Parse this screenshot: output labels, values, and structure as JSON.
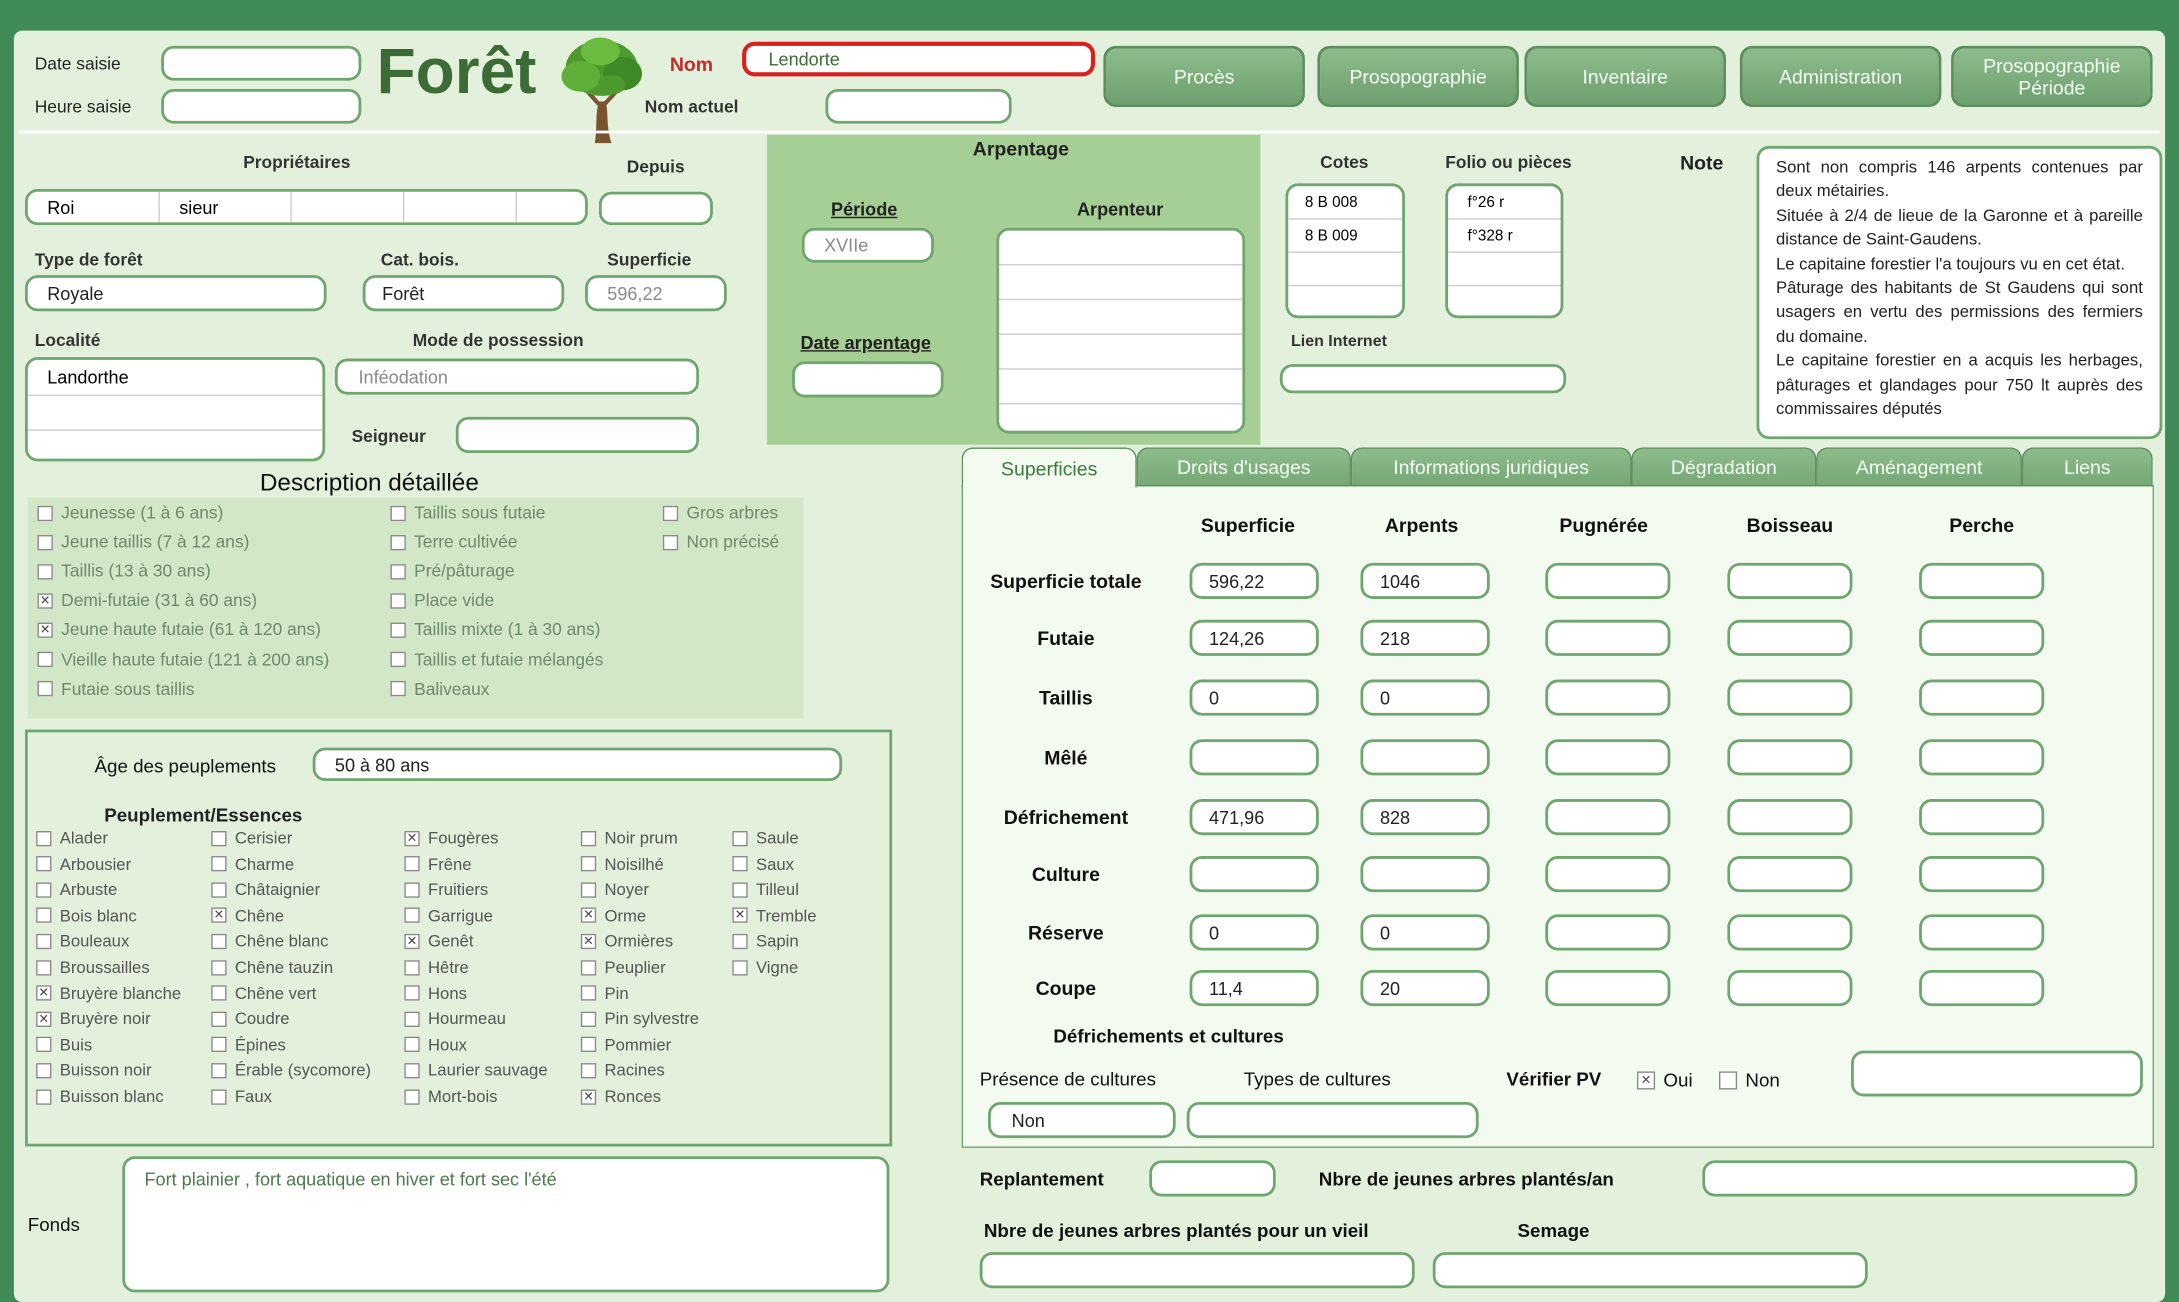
{
  "header": {
    "date_saisie_label": "Date saisie",
    "heure_saisie_label": "Heure saisie",
    "title": "Forêt",
    "nom_label": "Nom",
    "nom_value": "Lendorte",
    "nom_actuel_label": "Nom actuel",
    "nav": [
      "Procès",
      "Prosopographie",
      "Inventaire",
      "Administration",
      "Prosopographie Période"
    ]
  },
  "proprietaires": {
    "label": "Propriétaires",
    "values": [
      "Roi",
      "sieur",
      "",
      "",
      ""
    ],
    "depuis_label": "Depuis"
  },
  "type_foret": {
    "label": "Type de forêt",
    "value": "Royale"
  },
  "cat_bois": {
    "label": "Cat. bois.",
    "value": "Forêt"
  },
  "superficie": {
    "label": "Superficie",
    "value": "596,22"
  },
  "localite": {
    "label": "Localité",
    "value": "Landorthe"
  },
  "mode_possession": {
    "label": "Mode de possession",
    "value": "Inféodation"
  },
  "seigneur_label": "Seigneur",
  "arpentage": {
    "title": "Arpentage",
    "periode_label": "Période",
    "periode_value": "XVIIe",
    "arpenteur_label": "Arpenteur",
    "date_label": "Date arpentage"
  },
  "cotes": {
    "label": "Cotes",
    "values": [
      "8 B 008",
      "8 B 009"
    ]
  },
  "folio": {
    "label": "Folio ou pièces",
    "values": [
      "f°26 r",
      "f°328 r"
    ]
  },
  "lien_internet_label": "Lien Internet",
  "note": {
    "label": "Note",
    "paragraphs": [
      "Sont non compris 146 arpents contenues par deux métairies.",
      "Située à 2/4 de lieue de la Garonne et à pareille distance de Saint-Gaudens.",
      "Le capitaine forestier l'a toujours vu en cet état.",
      "Pâturage des habitants de St Gaudens qui sont usagers en vertu des permissions des fermiers du domaine.",
      "Le capitaine forestier en a acquis les herbages, pâturages et glandages pour 750 lt auprès des commissaires députés"
    ]
  },
  "description": {
    "title": "Description détaillée",
    "col1": [
      {
        "label": "Jeunesse (1 à 6 ans)",
        "checked": false
      },
      {
        "label": "Jeune taillis (7 à 12 ans)",
        "checked": false
      },
      {
        "label": "Taillis (13 à 30 ans)",
        "checked": false
      },
      {
        "label": "Demi-futaie (31 à 60 ans)",
        "checked": true
      },
      {
        "label": "Jeune haute futaie (61 à 120 ans)",
        "checked": true
      },
      {
        "label": "Vieille haute futaie (121 à 200 ans)",
        "checked": false
      },
      {
        "label": "Futaie sous taillis",
        "checked": false
      }
    ],
    "col2": [
      {
        "label": "Taillis sous futaie",
        "checked": false
      },
      {
        "label": "Terre cultivée",
        "checked": false
      },
      {
        "label": "Pré/pâturage",
        "checked": false
      },
      {
        "label": "Place vide",
        "checked": false
      },
      {
        "label": "Taillis mixte (1 à 30 ans)",
        "checked": false
      },
      {
        "label": "Taillis et futaie mélangés",
        "checked": false
      },
      {
        "label": "Baliveaux",
        "checked": false
      }
    ],
    "col3": [
      {
        "label": "Gros arbres",
        "checked": false
      },
      {
        "label": "Non précisé",
        "checked": false
      }
    ]
  },
  "age": {
    "label": "Âge des peuplements",
    "value": "50 à 80 ans"
  },
  "essences": {
    "title": "Peuplement/Essences",
    "col1": [
      {
        "label": "Alader",
        "checked": false
      },
      {
        "label": "Arbousier",
        "checked": false
      },
      {
        "label": "Arbuste",
        "checked": false
      },
      {
        "label": "Bois blanc",
        "checked": false
      },
      {
        "label": "Bouleaux",
        "checked": false
      },
      {
        "label": "Broussailles",
        "checked": false
      },
      {
        "label": "Bruyère blanche",
        "checked": true
      },
      {
        "label": "Bruyère noir",
        "checked": true
      },
      {
        "label": "Buis",
        "checked": false
      },
      {
        "label": "Buisson noir",
        "checked": false
      },
      {
        "label": "Buisson blanc",
        "checked": false
      }
    ],
    "col2": [
      {
        "label": "Cerisier",
        "checked": false
      },
      {
        "label": "Charme",
        "checked": false
      },
      {
        "label": "Châtaignier",
        "checked": false
      },
      {
        "label": "Chêne",
        "checked": true
      },
      {
        "label": "Chêne blanc",
        "checked": false
      },
      {
        "label": "Chêne tauzin",
        "checked": false
      },
      {
        "label": "Chêne vert",
        "checked": false
      },
      {
        "label": "Coudre",
        "checked": false
      },
      {
        "label": "Épines",
        "checked": false
      },
      {
        "label": "Érable (sycomore)",
        "checked": false
      },
      {
        "label": "Faux",
        "checked": false
      }
    ],
    "col3": [
      {
        "label": "Fougères",
        "checked": true
      },
      {
        "label": "Frêne",
        "checked": false
      },
      {
        "label": "Fruitiers",
        "checked": false
      },
      {
        "label": "Garrigue",
        "checked": false
      },
      {
        "label": "Genêt",
        "checked": true
      },
      {
        "label": "Hêtre",
        "checked": false
      },
      {
        "label": "Hons",
        "checked": false
      },
      {
        "label": "Hourmeau",
        "checked": false
      },
      {
        "label": "Houx",
        "checked": false
      },
      {
        "label": "Laurier sauvage",
        "checked": false
      },
      {
        "label": "Mort-bois",
        "checked": false
      }
    ],
    "col4": [
      {
        "label": "Noir prum",
        "checked": false
      },
      {
        "label": "Noisilhé",
        "checked": false
      },
      {
        "label": "Noyer",
        "checked": false
      },
      {
        "label": "Orme",
        "checked": true
      },
      {
        "label": "Ormières",
        "checked": true
      },
      {
        "label": "Peuplier",
        "checked": false
      },
      {
        "label": "Pin",
        "checked": false
      },
      {
        "label": "Pin sylvestre",
        "checked": false
      },
      {
        "label": "Pommier",
        "checked": false
      },
      {
        "label": "Racines",
        "checked": false
      },
      {
        "label": "Ronces",
        "checked": true
      }
    ],
    "col5": [
      {
        "label": "Saule",
        "checked": false
      },
      {
        "label": "Saux",
        "checked": false
      },
      {
        "label": "Tilleul",
        "checked": false
      },
      {
        "label": "Tremble",
        "checked": true
      },
      {
        "label": "Sapin",
        "checked": false
      },
      {
        "label": "Vigne",
        "checked": false
      }
    ]
  },
  "fonds": {
    "label": "Fonds",
    "value": "Fort plainier , fort aquatique en hiver et fort sec l'été"
  },
  "tabs": [
    "Superficies",
    "Droits d'usages",
    "Informations juridiques",
    "Dégradation",
    "Aménagement",
    "Liens"
  ],
  "superficies": {
    "columns": [
      "Superficie",
      "Arpents",
      "Pugnérée",
      "Boisseau",
      "Perche"
    ],
    "rows": [
      {
        "label": "Superficie totale",
        "superficie": "596,22",
        "arpents": "1046"
      },
      {
        "label": "Futaie",
        "superficie": "124,26",
        "arpents": "218"
      },
      {
        "label": "Taillis",
        "superficie": "0",
        "arpents": "0"
      },
      {
        "label": "Mêlé",
        "superficie": "",
        "arpents": ""
      },
      {
        "label": "Défrichement",
        "superficie": "471,96",
        "arpents": "828"
      },
      {
        "label": "Culture",
        "superficie": "",
        "arpents": ""
      },
      {
        "label": "Réserve",
        "superficie": "0",
        "arpents": "0"
      },
      {
        "label": "Coupe",
        "superficie": "11,4",
        "arpents": "20"
      }
    ],
    "defrichements_title": "Défrichements et cultures",
    "presence_label": "Présence de cultures",
    "presence_value": "Non",
    "types_label": "Types de cultures",
    "verifier_label": "Vérifier PV",
    "oui_label": "Oui",
    "oui_checked": true,
    "non_label": "Non",
    "non_checked": false
  },
  "replantement_label": "Replantement",
  "nbre_an_label": "Nbre de jeunes arbres plantés/an",
  "nbre_vieil_label": "Nbre de jeunes arbres plantés pour un vieil",
  "semage_label": "Semage",
  "colors": {
    "window_green": "#3f8a56",
    "form_bg": "#e3f1dc",
    "panel_green": "#a6cf96",
    "field_border": "#6fa56f",
    "nom_border": "#d92020"
  }
}
